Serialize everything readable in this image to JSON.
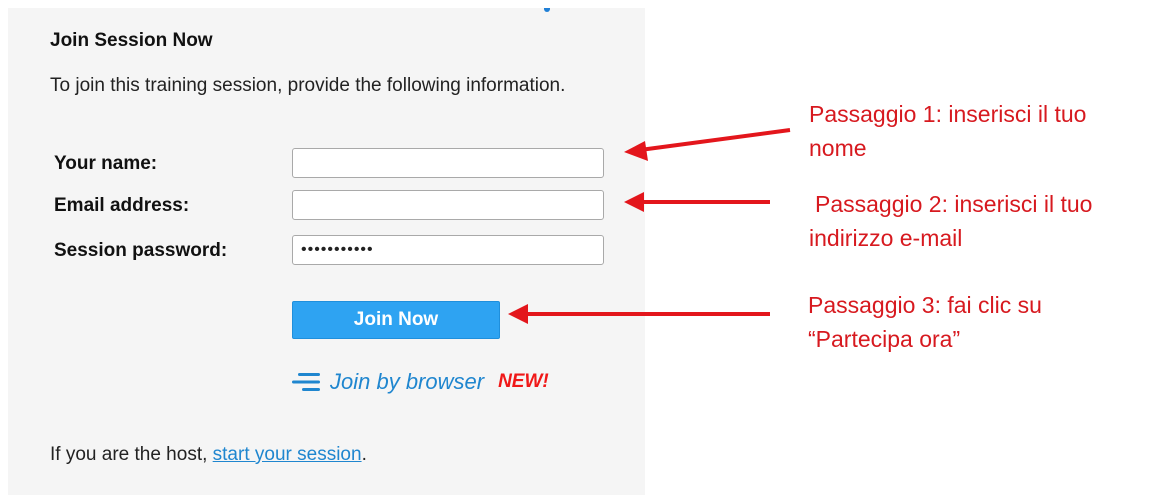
{
  "form": {
    "title": "Join Session Now",
    "intro": "To join this training session, provide the following information.",
    "name_label": "Your name:",
    "name_value": "",
    "email_label": "Email address:",
    "email_value": "",
    "password_label": "Session password:",
    "password_value": "•••••••••••",
    "join_button": "Join Now",
    "join_browser": "Join by browser",
    "new_badge": "NEW!",
    "host_prefix": "If you are the host, ",
    "host_link": "start your session",
    "host_suffix": "."
  },
  "annotations": {
    "step1_line1": "Passaggio 1: inserisci il tuo",
    "step1_line2": "nome",
    "step2_line1": "Passaggio 2:  inserisci il tuo",
    "step2_line2": "indirizzo e-mail",
    "step3_line1": "Passaggio 3: fai clic su",
    "step3_line2": "“Partecipa ora”"
  },
  "colors": {
    "annotation_red": "#d7191f",
    "button_blue": "#2ea3f2",
    "link_blue": "#1f86cf",
    "new_red": "#f01818",
    "panel_bg": "#f5f5f5"
  },
  "icons": {
    "browser_icon": "three-horizontal-lines-icon",
    "arrow": "red-left-arrow"
  }
}
